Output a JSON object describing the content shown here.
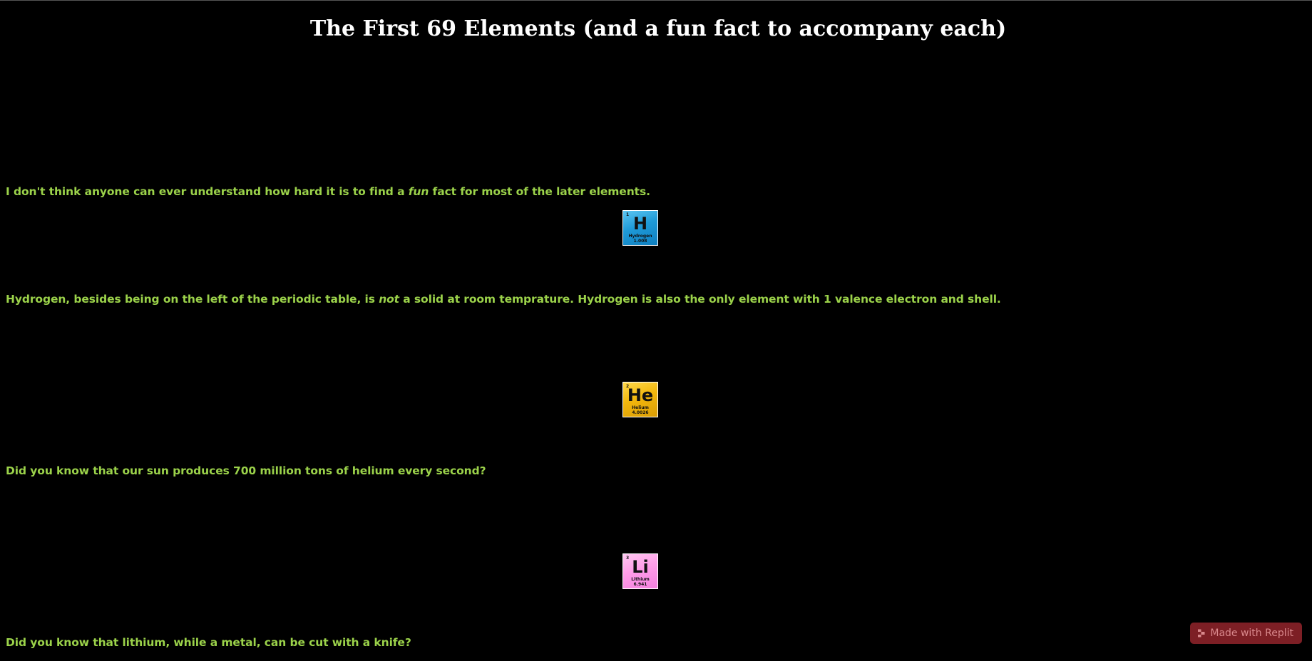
{
  "page": {
    "title": "The First 69 Elements (and a fun fact to accompany each)",
    "intro": {
      "before": "I don't think anyone can ever understand how hard it is to find a ",
      "em": "fun",
      "after": " fact for most of the later elements."
    }
  },
  "elements": [
    {
      "number": "1",
      "symbol": "H",
      "name": "Hydrogen",
      "mass": "1.008",
      "fact": {
        "before": "Hydrogen, besides being on the left of the periodic table, is ",
        "em": "not",
        "after": " a solid at room temprature. Hydrogen is also the only element with 1 valence electron and shell."
      }
    },
    {
      "number": "2",
      "symbol": "He",
      "name": "Helium",
      "mass": "4.0026",
      "fact": {
        "text": "Did you know that our sun produces 700 million tons of helium every second?"
      }
    },
    {
      "number": "3",
      "symbol": "Li",
      "name": "Lithium",
      "mass": "6.941",
      "fact": {
        "text": "Did you know that lithium, while a metal, can be cut with a knife?"
      }
    }
  ],
  "badge": {
    "label": "Made with Replit",
    "icon": "replit-icon"
  },
  "colors": {
    "background": "#000000",
    "fact_text": "#9bd24a",
    "title_text": "#ffffff",
    "badge_bg": "#7d1f25"
  }
}
